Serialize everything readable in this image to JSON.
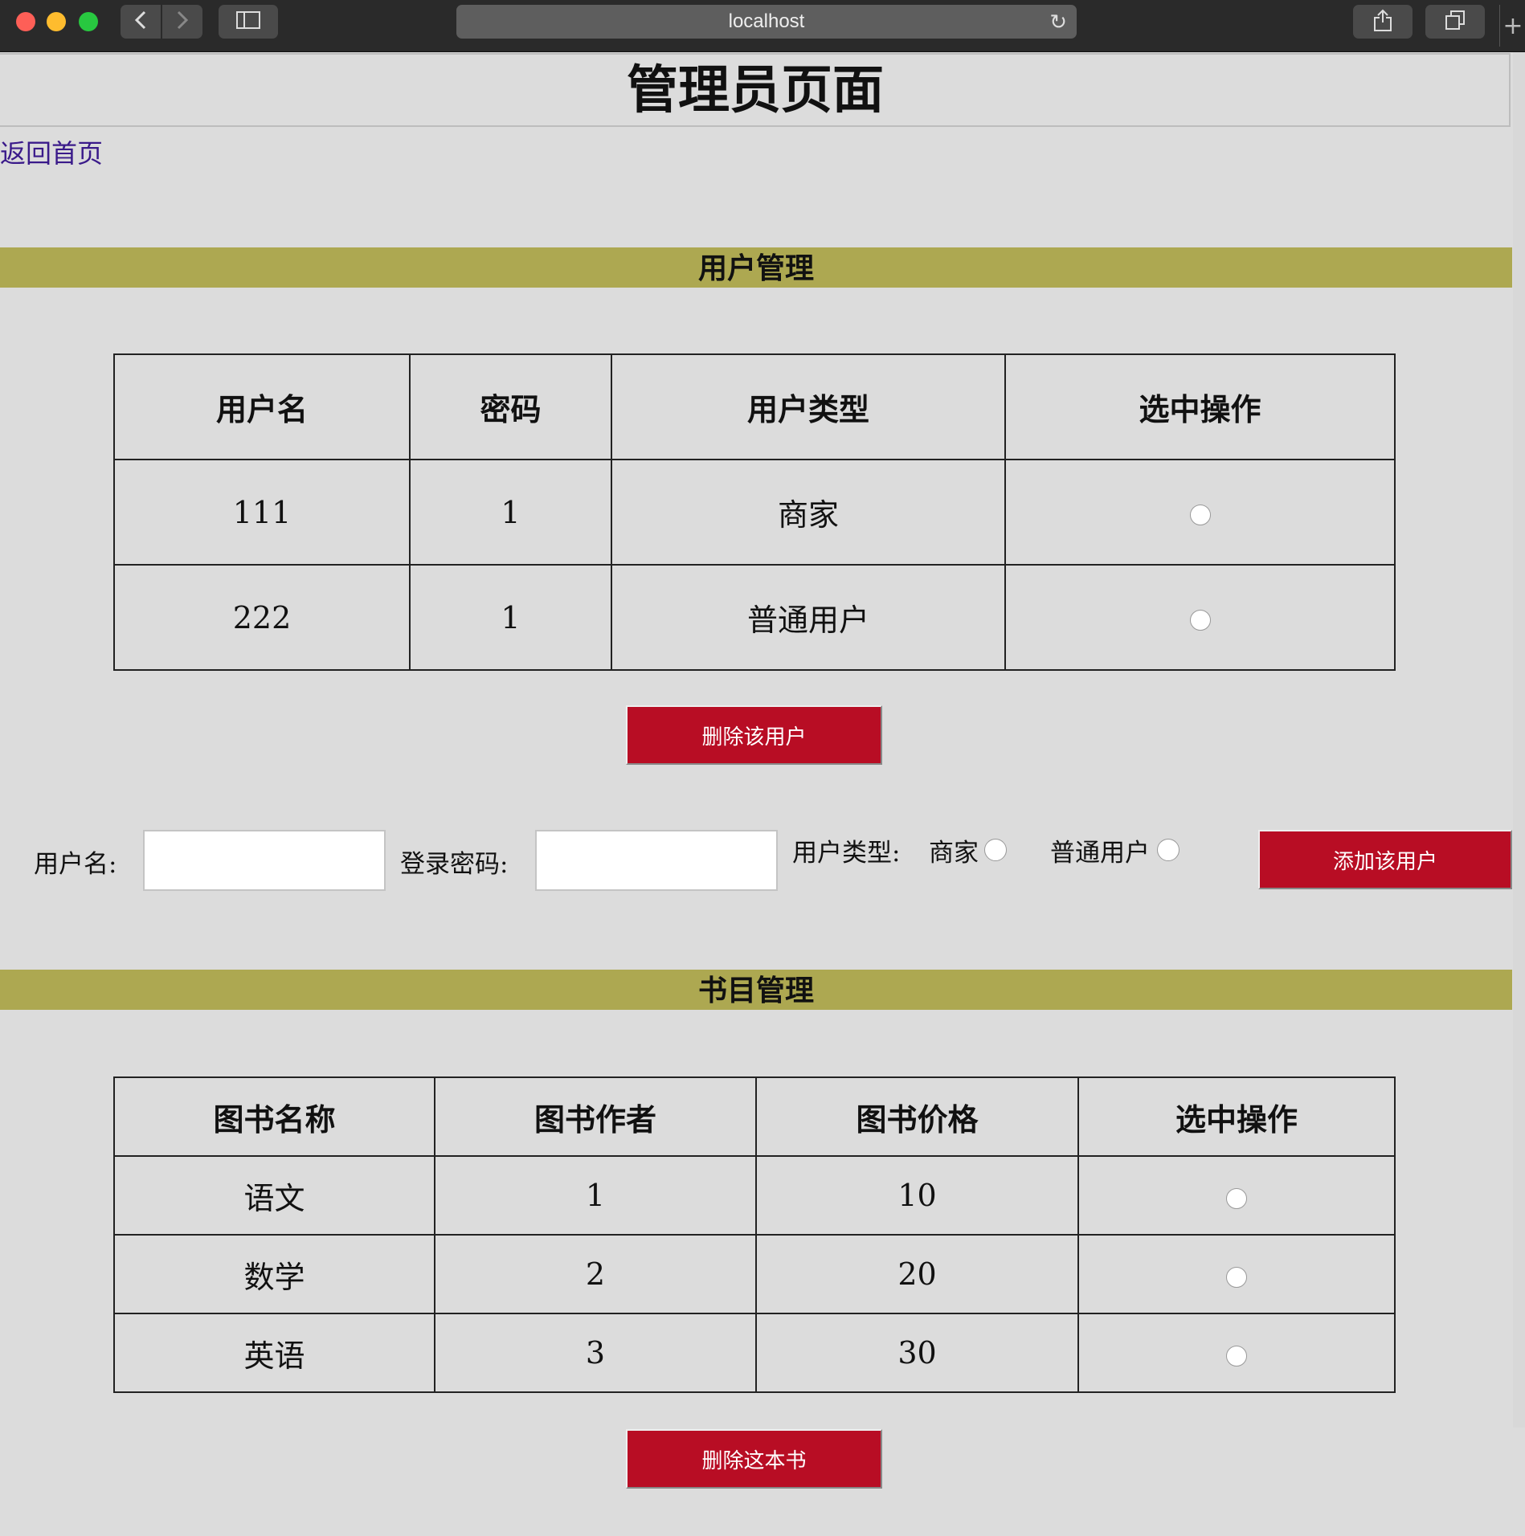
{
  "browser": {
    "url": "localhost"
  },
  "page": {
    "title": "管理员页面",
    "home_link": "返回首页"
  },
  "user_section": {
    "heading": "用户管理",
    "columns": [
      "用户名",
      "密码",
      "用户类型",
      "选中操作"
    ],
    "rows": [
      {
        "username": "111",
        "password": "1",
        "type": "商家"
      },
      {
        "username": "222",
        "password": "1",
        "type": "普通用户"
      }
    ],
    "delete_button": "删除该用户",
    "form": {
      "username_label": "用户名:",
      "username_value": "",
      "password_label": "登录密码:",
      "password_value": "",
      "type_label": "用户类型:",
      "type_options": [
        "商家",
        "普通用户"
      ],
      "add_button": "添加该用户"
    }
  },
  "book_section": {
    "heading": "书目管理",
    "columns": [
      "图书名称",
      "图书作者",
      "图书价格",
      "选中操作"
    ],
    "rows": [
      {
        "name": "语文",
        "author": "1",
        "price": "10"
      },
      {
        "name": "数学",
        "author": "2",
        "price": "20"
      },
      {
        "name": "英语",
        "author": "3",
        "price": "30"
      }
    ],
    "delete_button": "删除这本书"
  },
  "colors": {
    "band": "#ada851",
    "button": "#b80d24",
    "link": "#3a1a8a",
    "page_bg": "#dcdcdc"
  },
  "icons": [
    "back-icon",
    "forward-icon",
    "sidebar-icon",
    "reload-icon",
    "share-icon",
    "tabs-icon",
    "new-tab-icon"
  ]
}
